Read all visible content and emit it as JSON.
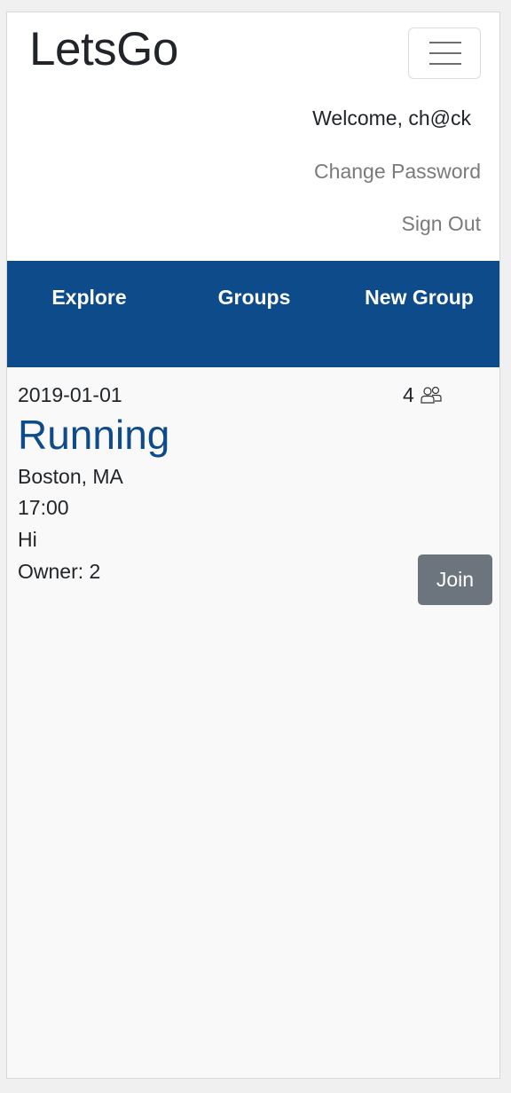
{
  "app": {
    "brand": "LetsGo"
  },
  "user_menu": {
    "welcome": "Welcome, ch@ck",
    "change_password": "Change Password",
    "sign_out": "Sign Out"
  },
  "tabs": [
    {
      "label": "Explore"
    },
    {
      "label": "Groups"
    },
    {
      "label": "New Group"
    }
  ],
  "group": {
    "date": "2019-01-01",
    "member_count": "4",
    "member_icon": "people-icon",
    "title": "Running",
    "location": "Boston, MA",
    "time": "17:00",
    "description": "Hi",
    "owner": "Owner: 2",
    "join_label": "Join"
  },
  "colors": {
    "brand_blue": "#0d4b8a",
    "join_button": "#6c757d",
    "muted_text": "#7a7a7a",
    "page_background": "#f9f9f9"
  }
}
